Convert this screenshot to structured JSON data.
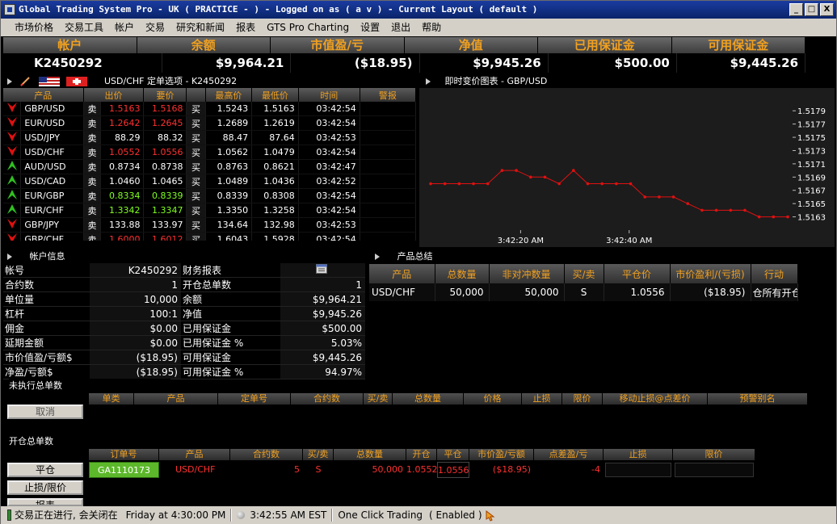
{
  "window": {
    "title": "Global Trading System Pro - UK ( PRACTICE -   ) - Logged on as ( a v ) - Current Layout ( default )",
    "min": "_",
    "max": "□",
    "close": "X"
  },
  "menu": [
    "市场价格",
    "交易工具",
    "帐户",
    "交易",
    "研究和新闻",
    "报表",
    "GTS Pro Charting",
    "设置",
    "退出",
    "帮助"
  ],
  "summary": {
    "headers": [
      "帐户",
      "余额",
      "市值盈/亏",
      "净值",
      "已用保证金",
      "可用保证金"
    ],
    "values": [
      "K2450292",
      "$9,964.21",
      "($18.95)",
      "$9,945.26",
      "$500.00",
      "$9,445.26"
    ]
  },
  "quotes": {
    "title": "USD/CHF 定单选项 - K2450292",
    "columns": [
      "产品",
      "出价",
      "要价",
      "",
      "最高价",
      "最低价",
      "时间",
      "警报"
    ],
    "rows": [
      {
        "dir": "down",
        "symbol": "GBP/USD",
        "sell": "卖",
        "bid": "1.5163",
        "ask": "1.5168",
        "buy": "买",
        "high": "1.5243",
        "low": "1.5163",
        "time": "03:42:54",
        "color": "red"
      },
      {
        "dir": "down",
        "symbol": "EUR/USD",
        "sell": "卖",
        "bid": "1.2642",
        "ask": "1.2645",
        "buy": "买",
        "high": "1.2689",
        "low": "1.2619",
        "time": "03:42:54",
        "color": "red"
      },
      {
        "dir": "down",
        "symbol": "USD/JPY",
        "sell": "卖",
        "bid": "88.29",
        "ask": "88.32",
        "buy": "买",
        "high": "88.47",
        "low": "87.64",
        "time": "03:42:53",
        "color": "white"
      },
      {
        "dir": "down",
        "symbol": "USD/CHF",
        "sell": "卖",
        "bid": "1.0552",
        "ask": "1.0556",
        "buy": "买",
        "high": "1.0562",
        "low": "1.0479",
        "time": "03:42:54",
        "color": "red"
      },
      {
        "dir": "up",
        "symbol": "AUD/USD",
        "sell": "卖",
        "bid": "0.8734",
        "ask": "0.8738",
        "buy": "买",
        "high": "0.8763",
        "low": "0.8621",
        "time": "03:42:47",
        "color": "white"
      },
      {
        "dir": "up",
        "symbol": "USD/CAD",
        "sell": "卖",
        "bid": "1.0460",
        "ask": "1.0465",
        "buy": "买",
        "high": "1.0489",
        "low": "1.0436",
        "time": "03:42:52",
        "color": "white"
      },
      {
        "dir": "up",
        "symbol": "EUR/GBP",
        "sell": "卖",
        "bid": "0.8334",
        "ask": "0.8339",
        "buy": "买",
        "high": "0.8339",
        "low": "0.8308",
        "time": "03:42:54",
        "color": "green"
      },
      {
        "dir": "up",
        "symbol": "EUR/CHF",
        "sell": "卖",
        "bid": "1.3342",
        "ask": "1.3347",
        "buy": "买",
        "high": "1.3350",
        "low": "1.3258",
        "time": "03:42:54",
        "color": "green"
      },
      {
        "dir": "down",
        "symbol": "GBP/JPY",
        "sell": "卖",
        "bid": "133.88",
        "ask": "133.97",
        "buy": "买",
        "high": "134.64",
        "low": "132.98",
        "time": "03:42:53",
        "color": "white"
      },
      {
        "dir": "down",
        "symbol": "GBP/CHF",
        "sell": "卖",
        "bid": "1.6000",
        "ask": "1.6012",
        "buy": "买",
        "high": "1.6043",
        "low": "1.5928",
        "time": "03:42:54",
        "color": "red"
      }
    ]
  },
  "chart_panel": {
    "title": "即时变价图表 - GBP/USD"
  },
  "chart_data": {
    "type": "line",
    "x": [
      0,
      1,
      2,
      3,
      4,
      5,
      6,
      7,
      8,
      9,
      10,
      11,
      12,
      13,
      14,
      15,
      16,
      17,
      18,
      19,
      20,
      21,
      22,
      23,
      24,
      25
    ],
    "values": [
      1.5168,
      1.5168,
      1.5168,
      1.5168,
      1.5168,
      1.517,
      1.517,
      1.5169,
      1.5169,
      1.5168,
      1.517,
      1.5168,
      1.5168,
      1.5168,
      1.5168,
      1.5166,
      1.5166,
      1.5166,
      1.5165,
      1.5164,
      1.5164,
      1.5164,
      1.5164,
      1.5163,
      1.5163,
      1.5163
    ],
    "ylim": [
      1.5161,
      1.518
    ],
    "yticks": [
      "1.5179",
      "1.5177",
      "1.5175",
      "1.5173",
      "1.5171",
      "1.5169",
      "1.5167",
      "1.5165",
      "1.5163"
    ],
    "xticks": [
      {
        "label": "3:42:20 AM",
        "x": 6.3
      },
      {
        "label": "3:42:40 AM",
        "x": 13.9
      }
    ],
    "color": "#e01010"
  },
  "account": {
    "title": "帐户信息",
    "rows": [
      [
        "帐号",
        "K2450292",
        "财务报表",
        ""
      ],
      [
        "合约数",
        "1",
        "开仓总单数",
        "1"
      ],
      [
        "单位量",
        "10,000",
        "余额",
        "$9,964.21"
      ],
      [
        "杠杆",
        "100:1",
        "净值",
        "$9,945.26"
      ],
      [
        "佣金",
        "$0.00",
        "已用保证金",
        "$500.00"
      ],
      [
        "延期金额",
        "$0.00",
        "已用保证金 %",
        "5.03%"
      ],
      [
        "市价值盈/亏额$",
        "($18.95)",
        "可用保证金",
        "$9,445.26"
      ],
      [
        "净盈/亏额$",
        "($18.95)",
        "可用保证金 %",
        "94.97%"
      ]
    ]
  },
  "product": {
    "title": "产品总结",
    "columns": [
      "产品",
      "总数量",
      "非对冲数量",
      "买/卖",
      "平仓价",
      "市价盈利/(亏损)",
      "行动"
    ],
    "row": [
      "USD/CHF",
      "50,000",
      "50,000",
      "S",
      "1.0556",
      "($18.95)",
      "仓所有开仓"
    ]
  },
  "pending": {
    "title": "未执行总单数",
    "columns": [
      "单类",
      "产品",
      "定单号",
      "合约数",
      "买/卖",
      "总数量",
      "价格",
      "止损",
      "限价",
      "移动止损@点差价",
      "预警别名"
    ],
    "cancel": "取消"
  },
  "open": {
    "title": "开仓总单数",
    "columns": [
      "订单号",
      "产品",
      "合约数",
      "买/卖",
      "总数量",
      "开仓",
      "平仓",
      "市价盈/亏额",
      "点差盈/亏",
      "止损",
      "限价"
    ],
    "row": [
      "GA1110173",
      "USD/CHF",
      "5",
      "S",
      "50,000",
      "1.0552",
      "1.0556",
      "($18.95)",
      "-4",
      "",
      ""
    ],
    "close_btn": "平仓",
    "stop_btn": "止损/限价",
    "report_btn": "报表"
  },
  "status": {
    "trading": "交易正在进行, 会关闭在",
    "close_time": "Friday at 4:30:00 PM",
    "clock": "3:42:55 AM EST",
    "one_click": "One Click Trading",
    "enabled": "( Enabled )"
  }
}
